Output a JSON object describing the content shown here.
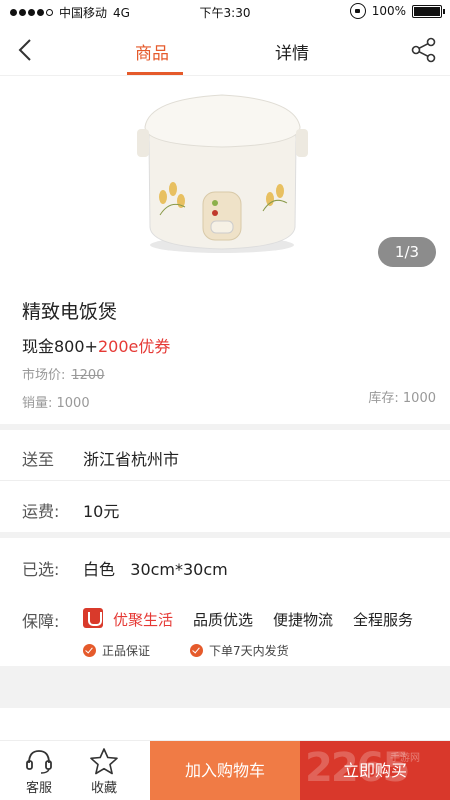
{
  "status_bar": {
    "carrier": "中国移动",
    "network": "4G",
    "time": "下午3:30",
    "battery": "100%"
  },
  "nav": {
    "tabs": [
      {
        "label": "商品",
        "active": true
      },
      {
        "label": "详情",
        "active": false
      }
    ]
  },
  "gallery": {
    "page_indicator": "1/3"
  },
  "product": {
    "title": "精致电饭煲",
    "price_cash": "现金800+",
    "price_coupon": "200e优券",
    "market_price_label": "市场价:",
    "market_price_value": "1200",
    "sales": "销量: 1000",
    "stock": "库存: 1000"
  },
  "delivery": {
    "label": "送至",
    "value": "浙江省杭州市"
  },
  "shipping": {
    "label": "运费:",
    "value": "10元"
  },
  "selected": {
    "label": "已选:",
    "value": "白色   30cm*30cm"
  },
  "guarantee": {
    "label": "保障:",
    "brand": "优聚生活",
    "items": [
      "品质优选",
      "便捷物流",
      "全程服务"
    ],
    "badges": [
      "正品保证",
      "下单7天内发货"
    ]
  },
  "bottom_bar": {
    "service_label": "客服",
    "favorite_label": "收藏",
    "add_to_cart_label": "加入购物车",
    "buy_now_label": "立即购买",
    "watermark": "2265",
    "watermark_sub": "手游网"
  },
  "colors": {
    "accent": "#e55a2b",
    "coupon_red": "#e53935",
    "cart_button": "#f07b45",
    "buy_button": "#d9382b"
  }
}
